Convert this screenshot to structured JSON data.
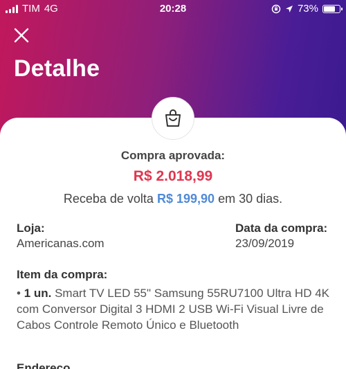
{
  "status_bar": {
    "carrier": "TIM",
    "network": "4G",
    "time": "20:28",
    "battery": "73%",
    "battery_level": 0.73
  },
  "header": {
    "title": "Detalhe",
    "close_icon": "close-icon"
  },
  "badge_icon": "shopping-bag-icon",
  "purchase": {
    "status_label": "Compra aprovada:",
    "amount": "R$ 2.018,99",
    "cashback_prefix": "Receba de volta",
    "cashback_value": "R$ 199,90",
    "cashback_suffix": "em 30 dias."
  },
  "store": {
    "label": "Loja:",
    "value": "Americanas.com"
  },
  "date": {
    "label": "Data da compra:",
    "value": "23/09/2019"
  },
  "item": {
    "title": "Item da compra:",
    "bullet": "•",
    "quantity": "1 un.",
    "description": "Smart TV LED 55\" Samsung 55RU7100 Ultra HD 4K com Conversor Digital 3 HDMI 2 USB Wi-Fi Visual Livre de Cabos Controle Remoto Único e Bluetooth"
  },
  "colors": {
    "amount": "#e0364f",
    "cashback": "#4f8ad6",
    "header_start": "#c2185b",
    "header_end": "#3b1a8f"
  }
}
